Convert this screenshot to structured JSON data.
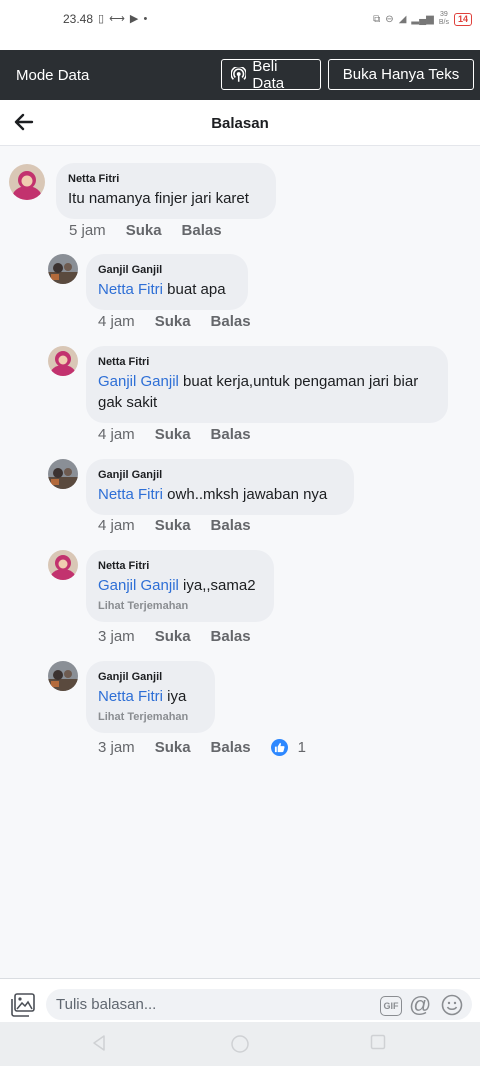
{
  "status_bar": {
    "time": "23.48",
    "left_icons": "▯ ⟷ ▶ •",
    "speed_top": "39",
    "speed_bottom": "B/s",
    "battery": "14"
  },
  "mode_bar": {
    "label": "Mode Data",
    "buy_button": "Beli Data",
    "text_only_button": "Buka Hanya Teks"
  },
  "header": {
    "title": "Balasan"
  },
  "comments": [
    {
      "author": "Netta Fitri",
      "mention": "",
      "text": "Itu namanya finjer jari karet",
      "time": "5 jam",
      "like": "Suka",
      "reply": "Balas"
    },
    {
      "author": "Ganjil Ganjil",
      "mention": "Netta Fitri",
      "text": " buat apa",
      "time": "4 jam",
      "like": "Suka",
      "reply": "Balas"
    },
    {
      "author": "Netta Fitri",
      "mention": "Ganjil Ganjil",
      "text": " buat kerja,untuk pengaman jari biar gak sakit",
      "time": "4 jam",
      "like": "Suka",
      "reply": "Balas"
    },
    {
      "author": "Ganjil Ganjil",
      "mention": "Netta Fitri",
      "text": " owh..mksh jawaban nya",
      "time": "4 jam",
      "like": "Suka",
      "reply": "Balas"
    },
    {
      "author": "Netta Fitri",
      "mention": "Ganjil Ganjil",
      "text": " iya,,sama2",
      "translate": "Lihat Terjemahan",
      "time": "3 jam",
      "like": "Suka",
      "reply": "Balas"
    },
    {
      "author": "Ganjil Ganjil",
      "mention": "Netta Fitri",
      "text": " iya",
      "translate": "Lihat Terjemahan",
      "time": "3 jam",
      "like": "Suka",
      "reply": "Balas",
      "like_count": "1"
    }
  ],
  "reply_bar": {
    "placeholder": "Tulis balasan...",
    "gif_label": "GIF",
    "at_symbol": "@"
  },
  "colors": {
    "mention": "#2e6fd6",
    "mode_bar_bg": "#2b2f33",
    "like_badge": "#2d88ff",
    "bubble_bg": "#eceef2"
  },
  "icons": [
    "back-arrow-icon",
    "radio-signal-icon",
    "photo-icon",
    "gif-icon",
    "at-icon",
    "emoji-icon",
    "thumbs-up-icon",
    "nav-back-icon",
    "nav-home-icon",
    "nav-recents-icon"
  ]
}
